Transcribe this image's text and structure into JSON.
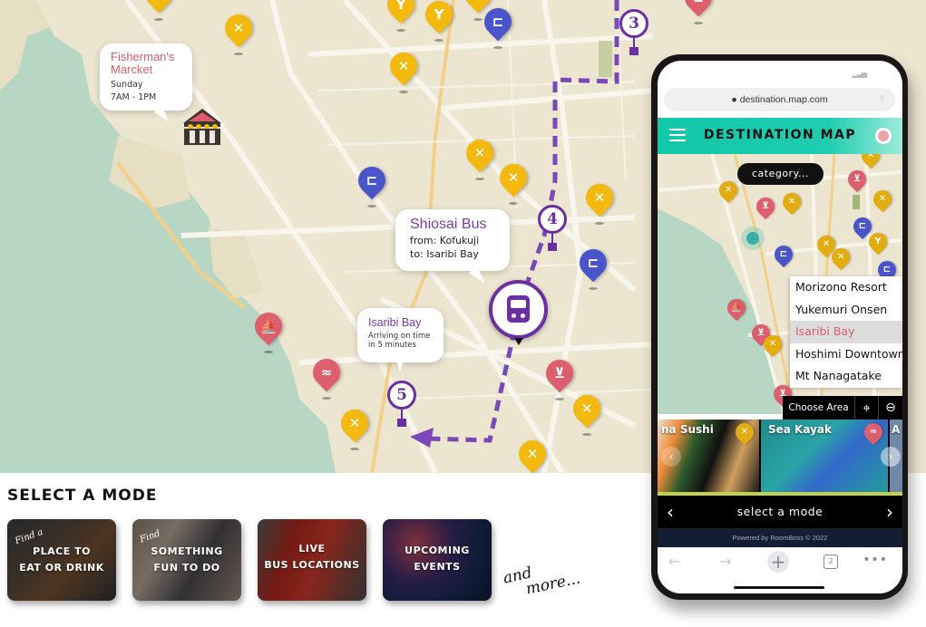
{
  "map": {
    "popups": {
      "fishermans_market": {
        "title": "Fisherman's Marcket",
        "line1": "Sunday",
        "line2": "7AM - 1PM"
      },
      "shiosai_bus": {
        "title": "Shiosai Bus",
        "line1": "from: Kofukuji",
        "line2": "to: Isaribi Bay"
      },
      "isaribi_bay": {
        "title": "Isaribi Bay",
        "line1": "Arriving on time",
        "line2": "in 5 minutes"
      }
    },
    "route_stops": [
      "3",
      "4",
      "5"
    ],
    "route_color": "#6a2fa0",
    "pin_colors": {
      "food": "#f4b90f",
      "hotel": "#4a55c9",
      "activity": "#dd5f6e"
    }
  },
  "select_mode": {
    "title": "SELECT A MODE",
    "cards": [
      {
        "script": "Find a",
        "label_line1": "PLACE TO",
        "label_line2": "EAT OR DRINK"
      },
      {
        "script": "Find",
        "label_line1": "SOMETHING",
        "label_line2": "FUN TO DO"
      },
      {
        "script": "",
        "label_line1": "LIVE",
        "label_line2": "BUS LOCATIONS"
      },
      {
        "script": "",
        "label_line1": "UPCOMING",
        "label_line2": "EVENTS"
      }
    ],
    "and_more_line1": "and",
    "and_more_line2": "more..."
  },
  "phone": {
    "url": "destination.map.com",
    "app_title": "DESTINATION MAP",
    "category_placeholder": "category...",
    "areas": [
      "Morizono Resort",
      "Yukemuri Onsen",
      "Isaribi Bay",
      "Hoshimi Downtown",
      "Mt Nanagatake"
    ],
    "selected_area": "Isaribi Bay",
    "choose_area_label": "Choose Area",
    "carousel": [
      "na Sushi",
      "Sea Kayak",
      "A"
    ],
    "mode_nav_label": "select a mode",
    "powered_by": "Powered by RoomBoss © 2022",
    "tab_count": "2"
  }
}
